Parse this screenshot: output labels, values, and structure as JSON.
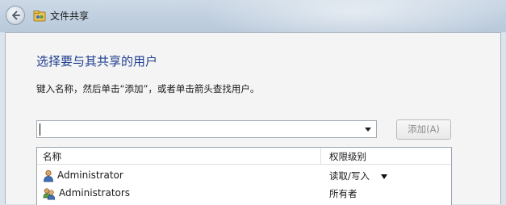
{
  "window": {
    "title": "文件共享"
  },
  "icons": {
    "back": "back-arrow-icon",
    "app": "file-sharing-icon",
    "user": "user-icon",
    "group": "group-icon"
  },
  "main": {
    "heading": "选择要与其共享的用户",
    "instruction": "键入名称，然后单击“添加”，或者单击箭头查找用户。",
    "combo": {
      "value": ""
    },
    "add_button": "添加(A)"
  },
  "table": {
    "columns": [
      "名称",
      "权限级别"
    ],
    "rows": [
      {
        "name": "Administrator",
        "permission": "读取/写入",
        "type": "user",
        "has_dropdown": true
      },
      {
        "name": "Administrators",
        "permission": "所有者",
        "type": "group",
        "has_dropdown": false
      }
    ]
  },
  "colors": {
    "heading": "#1d3d8f",
    "disabled_text": "#8d8d8d"
  }
}
